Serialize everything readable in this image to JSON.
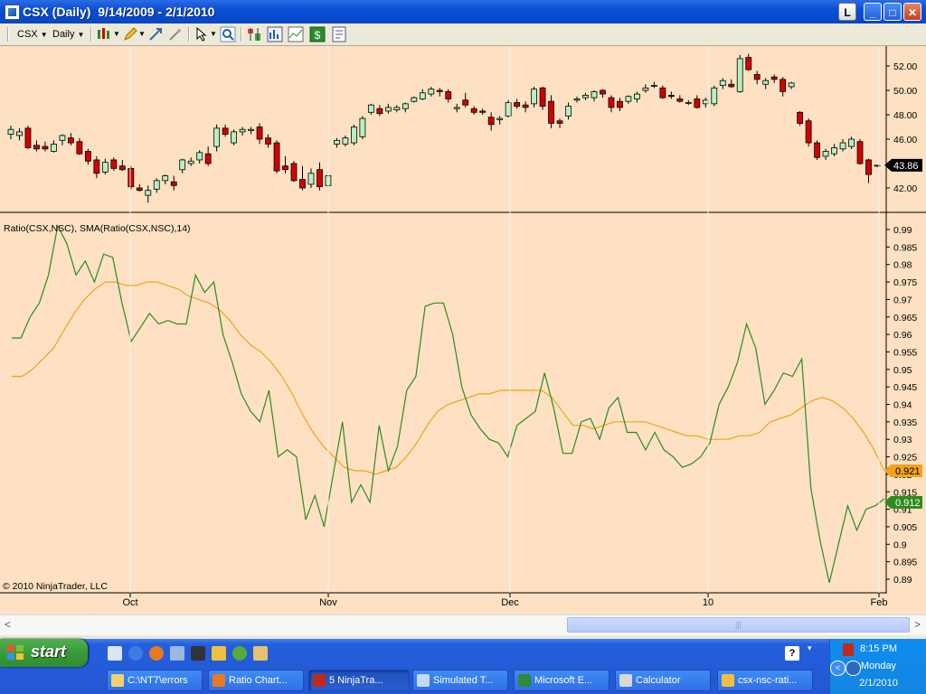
{
  "window": {
    "title": "CSX (Daily)  9/14/2009 - 2/1/2010",
    "controls": {
      "restore_small": "L",
      "minimize": "_",
      "maximize": "□",
      "close": "✕"
    }
  },
  "toolbar": {
    "instrument": "CSX",
    "period": "Daily",
    "icons": [
      "candlestick-style-icon",
      "pencil-draw-icon",
      "pan-icon",
      "zoom-icon",
      "cursor-pointer-icon",
      "magnifier-icon",
      "bar-chart-icon",
      "data-box-icon",
      "strategy-chart-icon",
      "dollar-icon",
      "properties-icon"
    ]
  },
  "colors": {
    "chart_bg": "#fde1c2",
    "up_candle": "#b7f0c0",
    "down_candle": "#d40000",
    "ratio_line": "#2e8b1f",
    "sma_line": "#f0a21b",
    "price_label_bg": "#000000",
    "ratio_label_bg": "#2e8b1f",
    "sma_label_bg": "#f0a21b"
  },
  "chart": {
    "indicator_label": "Ratio(CSX,NSC), SMA(Ratio(CSX,NSC),14)",
    "copyright": "© 2010 NinjaTrader, LLC",
    "price_axis": {
      "ticks": [
        "52.00",
        "50.00",
        "48.00",
        "46.00",
        "44.00",
        "42.00"
      ],
      "current": "43.86"
    },
    "indicator_axis": {
      "ticks": [
        "0.99",
        "0.985",
        "0.98",
        "0.975",
        "0.97",
        "0.965",
        "0.96",
        "0.955",
        "0.95",
        "0.945",
        "0.94",
        "0.935",
        "0.93",
        "0.925",
        "0.92",
        "0.915",
        "0.91",
        "0.905",
        "0.9",
        "0.895",
        "0.89"
      ],
      "sma_current": "0.921",
      "ratio_current": "0.912"
    },
    "x_labels": [
      "Oct",
      "Nov",
      "Dec",
      "10",
      "Feb"
    ]
  },
  "chart_data": [
    {
      "type": "candlestick",
      "title": "CSX (Daily)",
      "ylim": [
        41,
        53
      ],
      "candles": [
        {
          "o": 46.4,
          "h": 47.1,
          "l": 46.0,
          "c": 46.8
        },
        {
          "o": 46.3,
          "h": 46.9,
          "l": 45.9,
          "c": 46.6
        },
        {
          "o": 46.9,
          "h": 47.1,
          "l": 45.2,
          "c": 45.3
        },
        {
          "o": 45.5,
          "h": 45.9,
          "l": 45.0,
          "c": 45.2
        },
        {
          "o": 45.4,
          "h": 45.8,
          "l": 45.0,
          "c": 45.2
        },
        {
          "o": 45.0,
          "h": 45.9,
          "l": 44.9,
          "c": 45.6
        },
        {
          "o": 45.9,
          "h": 46.4,
          "l": 45.5,
          "c": 46.3
        },
        {
          "o": 46.1,
          "h": 46.5,
          "l": 45.5,
          "c": 45.7
        },
        {
          "o": 45.8,
          "h": 46.1,
          "l": 44.7,
          "c": 44.8
        },
        {
          "o": 45.0,
          "h": 45.2,
          "l": 43.9,
          "c": 44.2
        },
        {
          "o": 44.3,
          "h": 44.6,
          "l": 42.8,
          "c": 43.2
        },
        {
          "o": 43.3,
          "h": 44.4,
          "l": 43.1,
          "c": 44.1
        },
        {
          "o": 44.3,
          "h": 44.5,
          "l": 43.4,
          "c": 43.6
        },
        {
          "o": 43.8,
          "h": 44.3,
          "l": 43.4,
          "c": 43.5
        },
        {
          "o": 43.6,
          "h": 43.8,
          "l": 41.9,
          "c": 42.1
        },
        {
          "o": 42.0,
          "h": 42.3,
          "l": 41.7,
          "c": 41.8
        },
        {
          "o": 41.4,
          "h": 42.2,
          "l": 40.8,
          "c": 41.8
        },
        {
          "o": 41.9,
          "h": 42.8,
          "l": 41.6,
          "c": 42.6
        },
        {
          "o": 42.6,
          "h": 43.1,
          "l": 42.3,
          "c": 43.0
        },
        {
          "o": 42.5,
          "h": 43.0,
          "l": 41.8,
          "c": 42.2
        },
        {
          "o": 43.5,
          "h": 44.4,
          "l": 43.2,
          "c": 44.3
        },
        {
          "o": 44.0,
          "h": 44.5,
          "l": 43.8,
          "c": 44.2
        },
        {
          "o": 44.3,
          "h": 45.1,
          "l": 44.0,
          "c": 44.9
        },
        {
          "o": 44.8,
          "h": 45.4,
          "l": 43.8,
          "c": 44.0
        },
        {
          "o": 45.4,
          "h": 47.2,
          "l": 45.0,
          "c": 46.9
        },
        {
          "o": 46.9,
          "h": 47.2,
          "l": 46.2,
          "c": 46.4
        },
        {
          "o": 45.7,
          "h": 46.8,
          "l": 45.5,
          "c": 46.6
        },
        {
          "o": 46.6,
          "h": 47.0,
          "l": 46.3,
          "c": 46.8
        },
        {
          "o": 46.7,
          "h": 47.0,
          "l": 46.4,
          "c": 46.8
        },
        {
          "o": 47.0,
          "h": 47.3,
          "l": 45.6,
          "c": 46.0
        },
        {
          "o": 46.1,
          "h": 46.4,
          "l": 45.3,
          "c": 45.6
        },
        {
          "o": 45.7,
          "h": 45.9,
          "l": 43.2,
          "c": 43.4
        },
        {
          "o": 43.8,
          "h": 44.6,
          "l": 43.2,
          "c": 43.5
        },
        {
          "o": 44.0,
          "h": 44.2,
          "l": 42.5,
          "c": 42.6
        },
        {
          "o": 42.7,
          "h": 43.8,
          "l": 41.8,
          "c": 42.0
        },
        {
          "o": 42.3,
          "h": 43.6,
          "l": 42.0,
          "c": 43.2
        },
        {
          "o": 43.5,
          "h": 44.1,
          "l": 41.8,
          "c": 42.1
        },
        {
          "o": 42.2,
          "h": 43.4,
          "l": 42.0,
          "c": 43.0
        },
        {
          "o": 45.6,
          "h": 46.1,
          "l": 45.3,
          "c": 45.9
        },
        {
          "o": 45.6,
          "h": 46.3,
          "l": 45.4,
          "c": 46.1
        },
        {
          "o": 45.7,
          "h": 47.2,
          "l": 45.5,
          "c": 47.0
        },
        {
          "o": 46.2,
          "h": 47.9,
          "l": 46.0,
          "c": 47.7
        },
        {
          "o": 48.2,
          "h": 48.9,
          "l": 48.0,
          "c": 48.8
        },
        {
          "o": 48.5,
          "h": 48.8,
          "l": 47.9,
          "c": 48.1
        },
        {
          "o": 48.3,
          "h": 48.9,
          "l": 48.1,
          "c": 48.6
        },
        {
          "o": 48.4,
          "h": 48.8,
          "l": 48.2,
          "c": 48.6
        },
        {
          "o": 48.5,
          "h": 49.0,
          "l": 48.2,
          "c": 48.9
        },
        {
          "o": 49.1,
          "h": 49.5,
          "l": 49.0,
          "c": 49.4
        },
        {
          "o": 49.3,
          "h": 50.1,
          "l": 49.2,
          "c": 49.8
        },
        {
          "o": 49.7,
          "h": 50.3,
          "l": 49.5,
          "c": 50.1
        },
        {
          "o": 50.0,
          "h": 50.2,
          "l": 49.5,
          "c": 49.9
        },
        {
          "o": 49.9,
          "h": 50.1,
          "l": 49.0,
          "c": 49.3
        },
        {
          "o": 48.5,
          "h": 48.9,
          "l": 48.2,
          "c": 48.6
        },
        {
          "o": 49.2,
          "h": 49.8,
          "l": 48.6,
          "c": 48.8
        },
        {
          "o": 48.5,
          "h": 48.7,
          "l": 48.0,
          "c": 48.2
        },
        {
          "o": 48.3,
          "h": 48.5,
          "l": 48.0,
          "c": 48.2
        },
        {
          "o": 47.8,
          "h": 48.2,
          "l": 46.7,
          "c": 47.2
        },
        {
          "o": 47.6,
          "h": 47.9,
          "l": 47.2,
          "c": 47.7
        },
        {
          "o": 47.9,
          "h": 49.2,
          "l": 47.8,
          "c": 49.0
        },
        {
          "o": 49.0,
          "h": 49.3,
          "l": 48.5,
          "c": 48.7
        },
        {
          "o": 48.8,
          "h": 49.1,
          "l": 48.2,
          "c": 48.6
        },
        {
          "o": 48.9,
          "h": 50.3,
          "l": 48.6,
          "c": 50.1
        },
        {
          "o": 50.2,
          "h": 50.3,
          "l": 48.4,
          "c": 48.7
        },
        {
          "o": 49.1,
          "h": 49.6,
          "l": 46.9,
          "c": 47.3
        },
        {
          "o": 47.5,
          "h": 47.7,
          "l": 46.9,
          "c": 47.3
        },
        {
          "o": 47.9,
          "h": 49.0,
          "l": 47.6,
          "c": 48.7
        },
        {
          "o": 49.2,
          "h": 49.5,
          "l": 49.0,
          "c": 49.3
        },
        {
          "o": 49.4,
          "h": 49.8,
          "l": 49.2,
          "c": 49.6
        },
        {
          "o": 49.4,
          "h": 50.0,
          "l": 49.1,
          "c": 49.9
        },
        {
          "o": 50.0,
          "h": 50.1,
          "l": 49.4,
          "c": 49.7
        },
        {
          "o": 49.4,
          "h": 49.6,
          "l": 48.2,
          "c": 48.6
        },
        {
          "o": 49.1,
          "h": 49.4,
          "l": 48.3,
          "c": 48.6
        },
        {
          "o": 49.1,
          "h": 49.6,
          "l": 48.9,
          "c": 49.5
        },
        {
          "o": 49.3,
          "h": 49.9,
          "l": 49.0,
          "c": 49.7
        },
        {
          "o": 50.0,
          "h": 50.5,
          "l": 49.8,
          "c": 50.2
        },
        {
          "o": 50.4,
          "h": 50.7,
          "l": 50.2,
          "c": 50.4
        },
        {
          "o": 50.2,
          "h": 50.4,
          "l": 49.3,
          "c": 49.4
        },
        {
          "o": 49.6,
          "h": 49.9,
          "l": 49.3,
          "c": 49.5
        },
        {
          "o": 49.3,
          "h": 49.6,
          "l": 49.0,
          "c": 49.1
        },
        {
          "o": 49.0,
          "h": 49.2,
          "l": 48.8,
          "c": 49.0
        },
        {
          "o": 49.3,
          "h": 49.6,
          "l": 48.5,
          "c": 48.6
        },
        {
          "o": 48.9,
          "h": 49.4,
          "l": 48.6,
          "c": 49.2
        },
        {
          "o": 48.9,
          "h": 50.4,
          "l": 48.7,
          "c": 50.2
        },
        {
          "o": 50.4,
          "h": 51.0,
          "l": 50.1,
          "c": 50.8
        },
        {
          "o": 50.5,
          "h": 50.9,
          "l": 50.2,
          "c": 50.3
        },
        {
          "o": 49.9,
          "h": 52.9,
          "l": 49.8,
          "c": 52.6
        },
        {
          "o": 52.7,
          "h": 53.0,
          "l": 51.6,
          "c": 51.7
        },
        {
          "o": 51.3,
          "h": 51.6,
          "l": 50.5,
          "c": 50.9
        },
        {
          "o": 50.5,
          "h": 51.0,
          "l": 50.1,
          "c": 50.8
        },
        {
          "o": 51.1,
          "h": 51.3,
          "l": 50.6,
          "c": 50.9
        },
        {
          "o": 50.9,
          "h": 51.1,
          "l": 49.5,
          "c": 49.9
        },
        {
          "o": 50.3,
          "h": 50.7,
          "l": 50.1,
          "c": 50.6
        },
        {
          "o": 48.2,
          "h": 48.3,
          "l": 47.1,
          "c": 47.3
        },
        {
          "o": 47.5,
          "h": 47.7,
          "l": 45.4,
          "c": 45.7
        },
        {
          "o": 45.7,
          "h": 45.9,
          "l": 44.3,
          "c": 44.5
        },
        {
          "o": 44.6,
          "h": 45.2,
          "l": 44.3,
          "c": 45.0
        },
        {
          "o": 44.8,
          "h": 45.6,
          "l": 44.6,
          "c": 45.3
        },
        {
          "o": 45.2,
          "h": 46.0,
          "l": 45.0,
          "c": 45.7
        },
        {
          "o": 45.4,
          "h": 46.2,
          "l": 45.2,
          "c": 46.0
        },
        {
          "o": 45.8,
          "h": 46.0,
          "l": 43.9,
          "c": 44.0
        },
        {
          "o": 44.3,
          "h": 44.4,
          "l": 42.4,
          "c": 43.1
        },
        {
          "o": 43.8,
          "h": 43.9,
          "l": 43.7,
          "c": 43.86
        }
      ]
    },
    {
      "type": "line",
      "title": "Ratio(CSX,NSC), SMA(Ratio(CSX,NSC),14)",
      "ylim": [
        0.8875,
        0.9915
      ],
      "series": [
        {
          "name": "Ratio(CSX,NSC)",
          "values": [
            0.959,
            0.959,
            0.965,
            0.969,
            0.977,
            0.991,
            0.986,
            0.977,
            0.981,
            0.975,
            0.983,
            0.982,
            0.969,
            0.958,
            0.962,
            0.966,
            0.963,
            0.964,
            0.963,
            0.963,
            0.977,
            0.972,
            0.975,
            0.96,
            0.952,
            0.943,
            0.938,
            0.935,
            0.944,
            0.925,
            0.927,
            0.925,
            0.907,
            0.914,
            0.905,
            0.92,
            0.935,
            0.912,
            0.917,
            0.912,
            0.934,
            0.921,
            0.928,
            0.944,
            0.948,
            0.968,
            0.969,
            0.969,
            0.96,
            0.945,
            0.937,
            0.933,
            0.93,
            0.929,
            0.925,
            0.934,
            0.936,
            0.938,
            0.949,
            0.939,
            0.926,
            0.926,
            0.935,
            0.936,
            0.93,
            0.939,
            0.942,
            0.932,
            0.932,
            0.927,
            0.932,
            0.927,
            0.925,
            0.922,
            0.923,
            0.925,
            0.929,
            0.94,
            0.945,
            0.952,
            0.963,
            0.956,
            0.94,
            0.944,
            0.949,
            0.948,
            0.953,
            0.916,
            0.901,
            0.889,
            0.9,
            0.911,
            0.904,
            0.91,
            0.911,
            0.913
          ]
        },
        {
          "name": "SMA(Ratio(CSX,NSC),14)",
          "values": [
            0.948,
            0.948,
            0.95,
            0.953,
            0.956,
            0.961,
            0.966,
            0.97,
            0.973,
            0.975,
            0.975,
            0.974,
            0.974,
            0.975,
            0.975,
            0.974,
            0.973,
            0.971,
            0.97,
            0.969,
            0.967,
            0.964,
            0.96,
            0.957,
            0.955,
            0.952,
            0.948,
            0.943,
            0.937,
            0.932,
            0.928,
            0.925,
            0.922,
            0.921,
            0.921,
            0.92,
            0.921,
            0.922,
            0.925,
            0.929,
            0.934,
            0.938,
            0.94,
            0.941,
            0.942,
            0.943,
            0.943,
            0.944,
            0.944,
            0.944,
            0.944,
            0.944,
            0.942,
            0.938,
            0.934,
            0.934,
            0.933,
            0.934,
            0.935,
            0.935,
            0.935,
            0.935,
            0.934,
            0.933,
            0.932,
            0.931,
            0.931,
            0.93,
            0.93,
            0.93,
            0.931,
            0.931,
            0.932,
            0.935,
            0.936,
            0.937,
            0.939,
            0.941,
            0.942,
            0.941,
            0.939,
            0.936,
            0.932,
            0.927,
            0.921
          ]
        }
      ]
    }
  ],
  "scrollbar": {
    "left_arrow": "<",
    "right_arrow": ">",
    "grip": "|||"
  },
  "taskbar": {
    "start_label": "start",
    "tasks": [
      {
        "label": "C:\\NT7\\errors",
        "icon": "folder-icon",
        "color": "#f2d36b"
      },
      {
        "label": "Ratio Chart...",
        "icon": "firefox-icon",
        "color": "#e87a24"
      },
      {
        "label": "5 NinjaTra...",
        "icon": "ninjatrader-icon",
        "color": "#c12a1a"
      },
      {
        "label": "Simulated T...",
        "icon": "ib-icon",
        "color": "#c9d9f5"
      },
      {
        "label": "Microsoft E...",
        "icon": "excel-icon",
        "color": "#2f8a3a"
      },
      {
        "label": "Calculator",
        "icon": "calculator-icon",
        "color": "#d8d8d8"
      },
      {
        "label": "csx-nsc-rati...",
        "icon": "paint-icon",
        "color": "#f0c040"
      }
    ],
    "clock": {
      "time": "8:15 PM",
      "day": "Monday",
      "date": "2/1/2010"
    }
  }
}
